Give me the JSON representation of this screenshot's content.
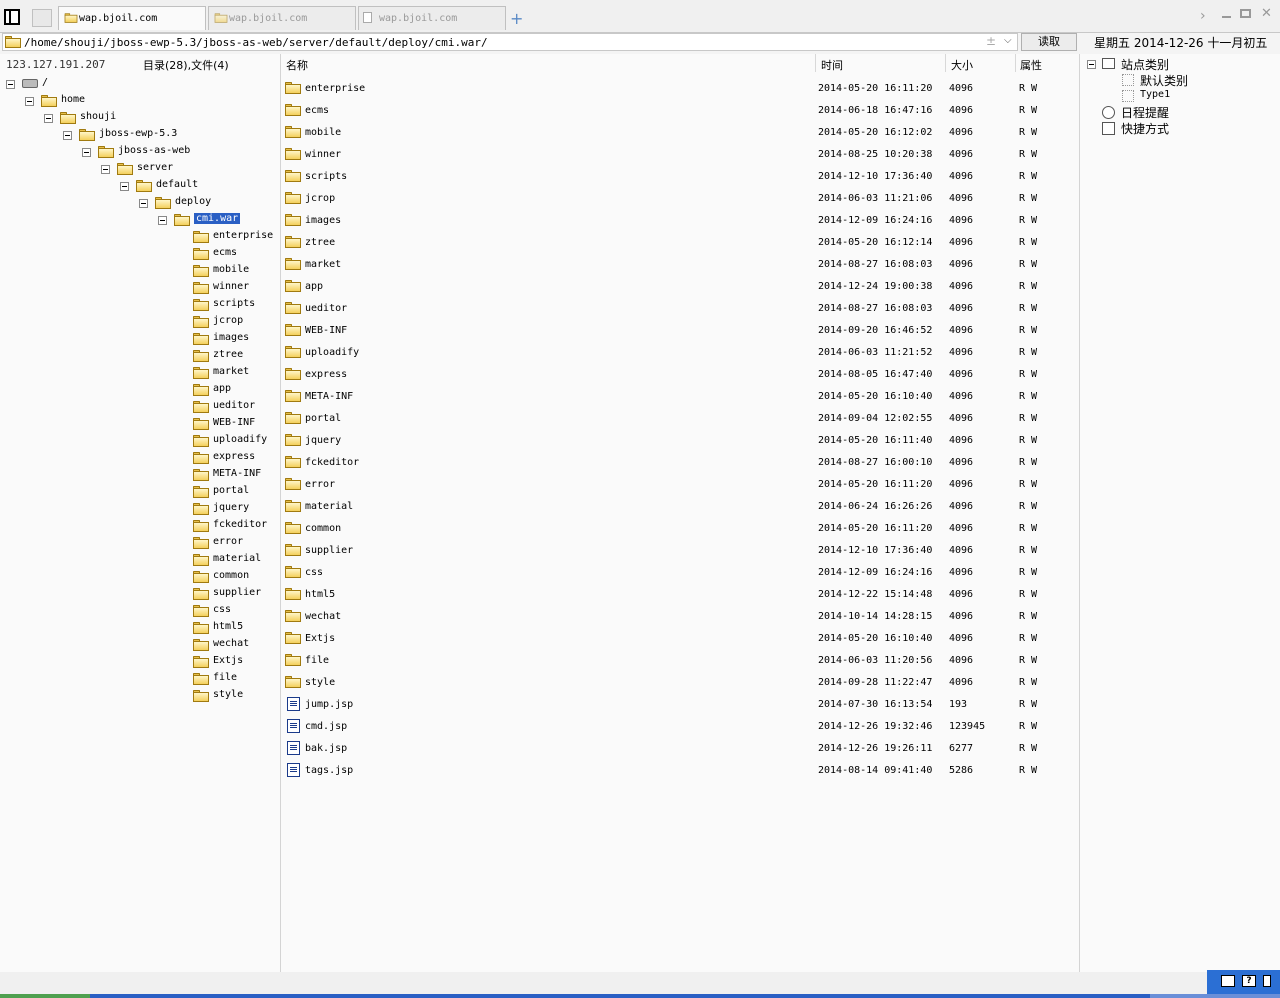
{
  "tabs": [
    {
      "label": "wap.bjoil.com",
      "active": true
    },
    {
      "label": "wap.bjoil.com",
      "active": false
    },
    {
      "label": "wap.bjoil.com",
      "active": false
    }
  ],
  "address": {
    "path": "/home/shouji/jboss-ewp-5.3/jboss-as-web/server/default/deploy/cmi.war/",
    "read_label": "读取"
  },
  "date": "星期五 2014-12-26 十一月初五",
  "status": {
    "ip": "123.127.191.207",
    "counts": "目录(28),文件(4)"
  },
  "columns": {
    "name": "名称",
    "time": "时间",
    "size": "大小",
    "attr": "属性"
  },
  "tree": [
    {
      "label": "/",
      "type": "drive",
      "depth": 0
    },
    {
      "label": "home",
      "type": "folder",
      "depth": 1
    },
    {
      "label": "shouji",
      "type": "folder",
      "depth": 2
    },
    {
      "label": "jboss-ewp-5.3",
      "type": "folder",
      "depth": 3
    },
    {
      "label": "jboss-as-web",
      "type": "folder",
      "depth": 4
    },
    {
      "label": "server",
      "type": "folder",
      "depth": 5
    },
    {
      "label": "default",
      "type": "folder",
      "depth": 6
    },
    {
      "label": "deploy",
      "type": "folder",
      "depth": 7
    },
    {
      "label": "cmi.war",
      "type": "folder",
      "depth": 8,
      "selected": true
    },
    {
      "label": "enterprise",
      "type": "folder",
      "depth": 9
    },
    {
      "label": "ecms",
      "type": "folder",
      "depth": 9
    },
    {
      "label": "mobile",
      "type": "folder",
      "depth": 9
    },
    {
      "label": "winner",
      "type": "folder",
      "depth": 9
    },
    {
      "label": "scripts",
      "type": "folder",
      "depth": 9
    },
    {
      "label": "jcrop",
      "type": "folder",
      "depth": 9
    },
    {
      "label": "images",
      "type": "folder",
      "depth": 9
    },
    {
      "label": "ztree",
      "type": "folder",
      "depth": 9
    },
    {
      "label": "market",
      "type": "folder",
      "depth": 9
    },
    {
      "label": "app",
      "type": "folder",
      "depth": 9
    },
    {
      "label": "ueditor",
      "type": "folder",
      "depth": 9
    },
    {
      "label": "WEB-INF",
      "type": "folder",
      "depth": 9
    },
    {
      "label": "uploadify",
      "type": "folder",
      "depth": 9
    },
    {
      "label": "express",
      "type": "folder",
      "depth": 9
    },
    {
      "label": "META-INF",
      "type": "folder",
      "depth": 9
    },
    {
      "label": "portal",
      "type": "folder",
      "depth": 9
    },
    {
      "label": "jquery",
      "type": "folder",
      "depth": 9
    },
    {
      "label": "fckeditor",
      "type": "folder",
      "depth": 9
    },
    {
      "label": "error",
      "type": "folder",
      "depth": 9
    },
    {
      "label": "material",
      "type": "folder",
      "depth": 9
    },
    {
      "label": "common",
      "type": "folder",
      "depth": 9
    },
    {
      "label": "supplier",
      "type": "folder",
      "depth": 9
    },
    {
      "label": "css",
      "type": "folder",
      "depth": 9
    },
    {
      "label": "html5",
      "type": "folder",
      "depth": 9
    },
    {
      "label": "wechat",
      "type": "folder",
      "depth": 9
    },
    {
      "label": "Extjs",
      "type": "folder",
      "depth": 9
    },
    {
      "label": "file",
      "type": "folder",
      "depth": 9
    },
    {
      "label": "style",
      "type": "folder",
      "depth": 9
    }
  ],
  "files": [
    {
      "name": "enterprise",
      "type": "folder",
      "time": "2014-05-20 16:11:20",
      "size": "4096",
      "attr": "R W"
    },
    {
      "name": "ecms",
      "type": "folder",
      "time": "2014-06-18 16:47:16",
      "size": "4096",
      "attr": "R W"
    },
    {
      "name": "mobile",
      "type": "folder",
      "time": "2014-05-20 16:12:02",
      "size": "4096",
      "attr": "R W"
    },
    {
      "name": "winner",
      "type": "folder",
      "time": "2014-08-25 10:20:38",
      "size": "4096",
      "attr": "R W"
    },
    {
      "name": "scripts",
      "type": "folder",
      "time": "2014-12-10 17:36:40",
      "size": "4096",
      "attr": "R W"
    },
    {
      "name": "jcrop",
      "type": "folder",
      "time": "2014-06-03 11:21:06",
      "size": "4096",
      "attr": "R W"
    },
    {
      "name": "images",
      "type": "folder",
      "time": "2014-12-09 16:24:16",
      "size": "4096",
      "attr": "R W"
    },
    {
      "name": "ztree",
      "type": "folder",
      "time": "2014-05-20 16:12:14",
      "size": "4096",
      "attr": "R W"
    },
    {
      "name": "market",
      "type": "folder",
      "time": "2014-08-27 16:08:03",
      "size": "4096",
      "attr": "R W"
    },
    {
      "name": "app",
      "type": "folder",
      "time": "2014-12-24 19:00:38",
      "size": "4096",
      "attr": "R W"
    },
    {
      "name": "ueditor",
      "type": "folder",
      "time": "2014-08-27 16:08:03",
      "size": "4096",
      "attr": "R W"
    },
    {
      "name": "WEB-INF",
      "type": "folder",
      "time": "2014-09-20 16:46:52",
      "size": "4096",
      "attr": "R W"
    },
    {
      "name": "uploadify",
      "type": "folder",
      "time": "2014-06-03 11:21:52",
      "size": "4096",
      "attr": "R W"
    },
    {
      "name": "express",
      "type": "folder",
      "time": "2014-08-05 16:47:40",
      "size": "4096",
      "attr": "R W"
    },
    {
      "name": "META-INF",
      "type": "folder",
      "time": "2014-05-20 16:10:40",
      "size": "4096",
      "attr": "R W"
    },
    {
      "name": "portal",
      "type": "folder",
      "time": "2014-09-04 12:02:55",
      "size": "4096",
      "attr": "R W"
    },
    {
      "name": "jquery",
      "type": "folder",
      "time": "2014-05-20 16:11:40",
      "size": "4096",
      "attr": "R W"
    },
    {
      "name": "fckeditor",
      "type": "folder",
      "time": "2014-08-27 16:00:10",
      "size": "4096",
      "attr": "R W"
    },
    {
      "name": "error",
      "type": "folder",
      "time": "2014-05-20 16:11:20",
      "size": "4096",
      "attr": "R W"
    },
    {
      "name": "material",
      "type": "folder",
      "time": "2014-06-24 16:26:26",
      "size": "4096",
      "attr": "R W"
    },
    {
      "name": "common",
      "type": "folder",
      "time": "2014-05-20 16:11:20",
      "size": "4096",
      "attr": "R W"
    },
    {
      "name": "supplier",
      "type": "folder",
      "time": "2014-12-10 17:36:40",
      "size": "4096",
      "attr": "R W"
    },
    {
      "name": "css",
      "type": "folder",
      "time": "2014-12-09 16:24:16",
      "size": "4096",
      "attr": "R W"
    },
    {
      "name": "html5",
      "type": "folder",
      "time": "2014-12-22 15:14:48",
      "size": "4096",
      "attr": "R W"
    },
    {
      "name": "wechat",
      "type": "folder",
      "time": "2014-10-14 14:28:15",
      "size": "4096",
      "attr": "R W"
    },
    {
      "name": "Extjs",
      "type": "folder",
      "time": "2014-05-20 16:10:40",
      "size": "4096",
      "attr": "R W"
    },
    {
      "name": "file",
      "type": "folder",
      "time": "2014-06-03 11:20:56",
      "size": "4096",
      "attr": "R W"
    },
    {
      "name": "style",
      "type": "folder",
      "time": "2014-09-28 11:22:47",
      "size": "4096",
      "attr": "R W"
    },
    {
      "name": "jump.jsp",
      "type": "file",
      "time": "2014-07-30 16:13:54",
      "size": "193",
      "attr": "R W"
    },
    {
      "name": "cmd.jsp",
      "type": "file",
      "time": "2014-12-26 19:32:46",
      "size": "123945",
      "attr": "R W"
    },
    {
      "name": "bak.jsp",
      "type": "file",
      "time": "2014-12-26 19:26:11",
      "size": "6277",
      "attr": "R W"
    },
    {
      "name": "tags.jsp",
      "type": "file",
      "time": "2014-08-14 09:41:40",
      "size": "5286",
      "attr": "R W"
    }
  ],
  "right_panel": {
    "site_category": "站点类别",
    "default_category": "默认类别",
    "type1": "Type1",
    "reminder": "日程提醒",
    "shortcut": "快捷方式"
  },
  "tray": {
    "help": "?"
  }
}
